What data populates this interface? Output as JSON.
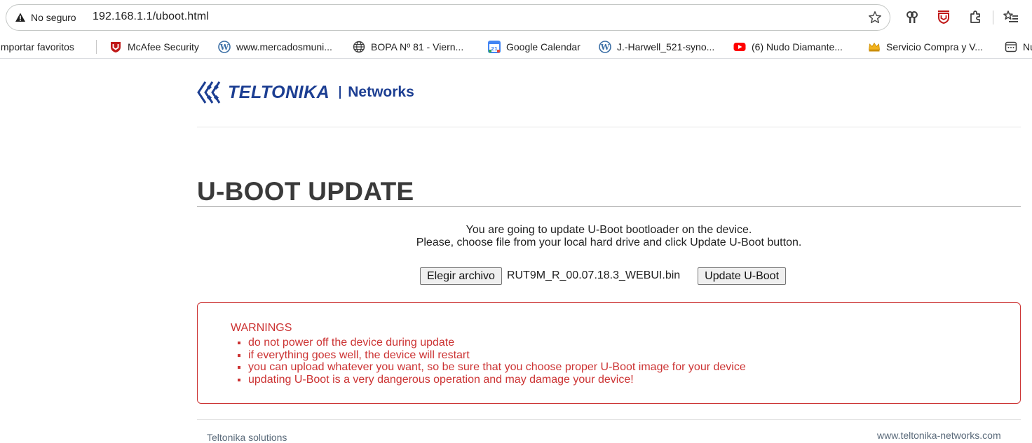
{
  "browser": {
    "security_label": "No seguro",
    "url": "192.168.1.1/uboot.html"
  },
  "bookmarks": [
    {
      "label": "Importar favoritos",
      "icon": "none"
    },
    {
      "label": "McAfee Security",
      "icon": "mcafee-icon"
    },
    {
      "label": "www.mercadosmuni...",
      "icon": "wordpress-icon"
    },
    {
      "label": "BOPA Nº 81 - Viern...",
      "icon": "globe-icon"
    },
    {
      "label": "Google Calendar",
      "icon": "calendar-icon"
    },
    {
      "label": "J.-Harwell_521-syno...",
      "icon": "wordpress-icon"
    },
    {
      "label": "(6) Nudo Diamante...",
      "icon": "youtube-icon"
    },
    {
      "label": "Servicio Compra y V...",
      "icon": "crown-icon"
    },
    {
      "label": "Nu",
      "icon": "app-icon"
    }
  ],
  "logo": {
    "brand": "TELTONIKA",
    "product": "Networks",
    "color": "#1c3e92"
  },
  "page": {
    "title": "U-BOOT UPDATE",
    "intro_line1": "You are going to update U-Boot bootloader on the device.",
    "intro_line2": "Please, choose file from your local hard drive and click Update U-Boot button.",
    "choose_file_label": "Elegir archivo",
    "file_name": "RUT9M_R_00.07.18.3_WEBUI.bin",
    "update_button_label": "Update U-Boot"
  },
  "warnings": {
    "title": "WARNINGS",
    "color": "#cc3333",
    "items": [
      "do not power off the device during update",
      "if everything goes well, the device will restart",
      "you can upload whatever you want, so be sure that you choose proper U-Boot image for your device",
      "updating U-Boot is a very dangerous operation and may damage your device!"
    ]
  },
  "footer": {
    "left": "Teltonika solutions",
    "right": "www.teltonika-networks.com"
  }
}
